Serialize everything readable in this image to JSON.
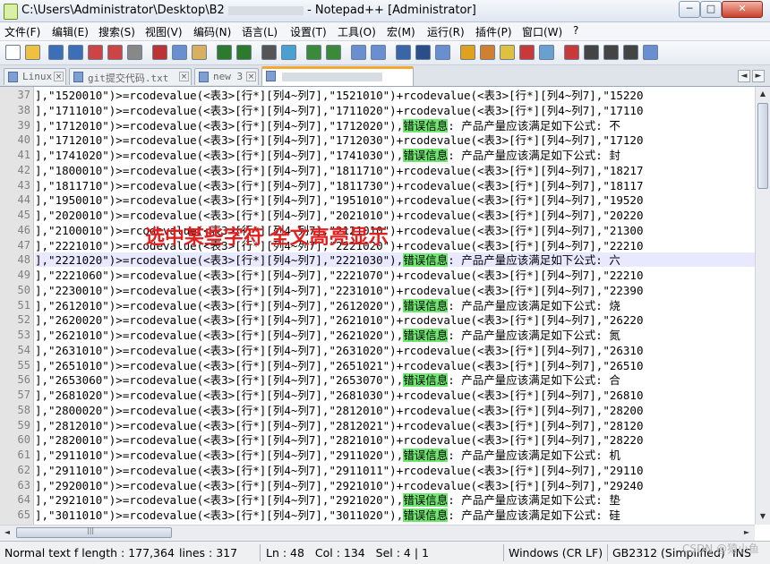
{
  "window": {
    "title": "C:\\Users\\Administrator\\Desktop\\B2 ",
    "title_app": "- Notepad++ [Administrator]",
    "minimize": "─",
    "maximize": "□",
    "close": "✕"
  },
  "menu": [
    "文件(F)",
    "编辑(E)",
    "搜索(S)",
    "视图(V)",
    "编码(N)",
    "语言(L)",
    "设置(T)",
    "工具(O)",
    "宏(M)",
    "运行(R)",
    "插件(P)",
    "窗口(W)",
    "?"
  ],
  "tabs": [
    {
      "label": "Linux",
      "active": false
    },
    {
      "label": "git提交代码.txt",
      "active": false
    },
    {
      "label": "new 3",
      "active": false
    },
    {
      "label": "",
      "active": true
    }
  ],
  "tab_scroll": {
    "left": "◄",
    "right": "►"
  },
  "annotation": "选中某些字符 全文高亮显示",
  "lines": [
    {
      "n": "37",
      "pre": "],\"1520010\")>=rcodevalue(<表3>[行*][列4~列7],\"1521010\")+rcodevalue(<表3>[行*][列4~列7],\"15220",
      "hl": "",
      "post": ""
    },
    {
      "n": "38",
      "pre": "],\"1711010\")>=rcodevalue(<表3>[行*][列4~列7],\"1711020\")+rcodevalue(<表3>[行*][列4~列7],\"17110",
      "hl": "",
      "post": ""
    },
    {
      "n": "39",
      "pre": "],\"1712010\")>=rcodevalue(<表3>[行*][列4~列7],\"1712020\"),",
      "hl": "错误信息",
      "post": ": 产品产量应该满足如下公式: 不"
    },
    {
      "n": "40",
      "pre": "],\"1712010\")>=rcodevalue(<表3>[行*][列4~列7],\"1712030\")+rcodevalue(<表3>[行*][列4~列7],\"17120",
      "hl": "",
      "post": ""
    },
    {
      "n": "41",
      "pre": "],\"1741020\")>=rcodevalue(<表3>[行*][列4~列7],\"1741030\"),",
      "hl": "错误信息",
      "post": ": 产品产量应该满足如下公式: 封"
    },
    {
      "n": "42",
      "pre": "],\"1800010\")>=rcodevalue(<表3>[行*][列4~列7],\"1811710\")+rcodevalue(<表3>[行*][列4~列7],\"18217",
      "hl": "",
      "post": ""
    },
    {
      "n": "43",
      "pre": "],\"1811710\")>=rcodevalue(<表3>[行*][列4~列7],\"1811730\")+rcodevalue(<表3>[行*][列4~列7],\"18117",
      "hl": "",
      "post": ""
    },
    {
      "n": "44",
      "pre": "],\"1950010\")>=rcodevalue(<表3>[行*][列4~列7],\"1951010\")+rcodevalue(<表3>[行*][列4~列7],\"19520",
      "hl": "",
      "post": ""
    },
    {
      "n": "45",
      "pre": "],\"2020010\")>=rcodevalue(<表3>[行*][列4~列7],\"2021010\")+rcodevalue(<表3>[行*][列4~列7],\"20220",
      "hl": "",
      "post": ""
    },
    {
      "n": "46",
      "pre": "],\"2100010\")>=rcodevalue(<表3>[行*][列4~列7],\"2121010\")+rcodevalue(<表3>[行*][列4~列7],\"21300",
      "hl": "",
      "post": ""
    },
    {
      "n": "47",
      "pre": "],\"2221010\")>=rcodevalue(<表3>[行*][列4~列7],\"2221020\")+rcodevalue(<表3>[行*][列4~列7],\"22210",
      "hl": "",
      "post": ""
    },
    {
      "n": "48",
      "pre": "],\"2221020\")>=rcodevalue(<表3>[行*][列4~列7],\"2221030\"),",
      "hl": "错误信息",
      "post": ": 产品产量应该满足如下公式: 六"
    },
    {
      "n": "49",
      "pre": "],\"2221060\")>=rcodevalue(<表3>[行*][列4~列7],\"2221070\")+rcodevalue(<表3>[行*][列4~列7],\"22210",
      "hl": "",
      "post": ""
    },
    {
      "n": "50",
      "pre": "],\"2230010\")>=rcodevalue(<表3>[行*][列4~列7],\"2231010\")+rcodevalue(<表3>[行*][列4~列7],\"22390",
      "hl": "",
      "post": ""
    },
    {
      "n": "51",
      "pre": "],\"2612010\")>=rcodevalue(<表3>[行*][列4~列7],\"2612020\"),",
      "hl": "错误信息",
      "post": ": 产品产量应该满足如下公式: 烧"
    },
    {
      "n": "52",
      "pre": "],\"2620020\")>=rcodevalue(<表3>[行*][列4~列7],\"2621010\")+rcodevalue(<表3>[行*][列4~列7],\"26220",
      "hl": "",
      "post": ""
    },
    {
      "n": "53",
      "pre": "],\"2621010\")>=rcodevalue(<表3>[行*][列4~列7],\"2621020\"),",
      "hl": "错误信息",
      "post": ": 产品产量应该满足如下公式: 氮"
    },
    {
      "n": "54",
      "pre": "],\"2631010\")>=rcodevalue(<表3>[行*][列4~列7],\"2631020\")+rcodevalue(<表3>[行*][列4~列7],\"26310",
      "hl": "",
      "post": ""
    },
    {
      "n": "55",
      "pre": "],\"2651010\")>=rcodevalue(<表3>[行*][列4~列7],\"2651021\")+rcodevalue(<表3>[行*][列4~列7],\"26510",
      "hl": "",
      "post": ""
    },
    {
      "n": "56",
      "pre": "],\"2653060\")>=rcodevalue(<表3>[行*][列4~列7],\"2653070\"),",
      "hl": "错误信息",
      "post": ": 产品产量应该满足如下公式: 合"
    },
    {
      "n": "57",
      "pre": "],\"2681020\")>=rcodevalue(<表3>[行*][列4~列7],\"2681030\")+rcodevalue(<表3>[行*][列4~列7],\"26810",
      "hl": "",
      "post": ""
    },
    {
      "n": "58",
      "pre": "],\"2800020\")>=rcodevalue(<表3>[行*][列4~列7],\"2812010\")+rcodevalue(<表3>[行*][列4~列7],\"28200",
      "hl": "",
      "post": ""
    },
    {
      "n": "59",
      "pre": "],\"2812010\")>=rcodevalue(<表3>[行*][列4~列7],\"2812021\")+rcodevalue(<表3>[行*][列4~列7],\"28120",
      "hl": "",
      "post": ""
    },
    {
      "n": "60",
      "pre": "],\"2820010\")>=rcodevalue(<表3>[行*][列4~列7],\"2821010\")+rcodevalue(<表3>[行*][列4~列7],\"28220",
      "hl": "",
      "post": ""
    },
    {
      "n": "61",
      "pre": "],\"2911010\")>=rcodevalue(<表3>[行*][列4~列7],\"2911020\"),",
      "hl": "错误信息",
      "post": ": 产品产量应该满足如下公式: 机"
    },
    {
      "n": "62",
      "pre": "],\"2911010\")>=rcodevalue(<表3>[行*][列4~列7],\"2911011\")+rcodevalue(<表3>[行*][列4~列7],\"29110",
      "hl": "",
      "post": ""
    },
    {
      "n": "63",
      "pre": "],\"2920010\")>=rcodevalue(<表3>[行*][列4~列7],\"2921010\")+rcodevalue(<表3>[行*][列4~列7],\"29240",
      "hl": "",
      "post": ""
    },
    {
      "n": "64",
      "pre": "],\"2921010\")>=rcodevalue(<表3>[行*][列4~列7],\"2921020\"),",
      "hl": "错误信息",
      "post": ": 产品产量应该满足如下公式: 垫"
    },
    {
      "n": "65",
      "pre": "],\"3011010\")>=rcodevalue(<表3>[行*][列4~列7],\"3011020\"),",
      "hl": "错误信息",
      "post": ": 产品产量应该满足如下公式: 硅"
    }
  ],
  "current_line": "48",
  "scroll": {
    "up": "▲",
    "down": "▼",
    "left": "◄",
    "right": "►",
    "grip": "|||"
  },
  "status": {
    "type_length": "Normal text f length : 177,364",
    "lines": "lines : 317",
    "position": "Ln : 48   Col : 134   Sel : 4 | 1",
    "eol": "Windows (CR LF)",
    "encoding": "GB2312 (Simplified)",
    "mode": "INS"
  },
  "watermark": "CSDN @猿小鱼",
  "toolbar_icons": [
    "new-file-icon",
    "open-file-icon",
    "save-icon",
    "save-all-icon",
    "close-icon",
    "close-all-icon",
    "print-icon",
    "cut-icon",
    "copy-icon",
    "paste-icon",
    "undo-icon",
    "redo-icon",
    "find-icon",
    "replace-icon",
    "zoom-in-icon",
    "zoom-out-icon",
    "sync-vertical-icon",
    "sync-horizontal-icon",
    "word-wrap-icon",
    "show-all-chars-icon",
    "indent-guide-icon",
    "language-icon",
    "doc-map-icon",
    "function-list-icon",
    "folder-workspace-icon",
    "monitor-icon",
    "record-macro-icon",
    "stop-macro-icon",
    "play-macro-icon",
    "run-macro-icon",
    "save-macro-icon"
  ]
}
